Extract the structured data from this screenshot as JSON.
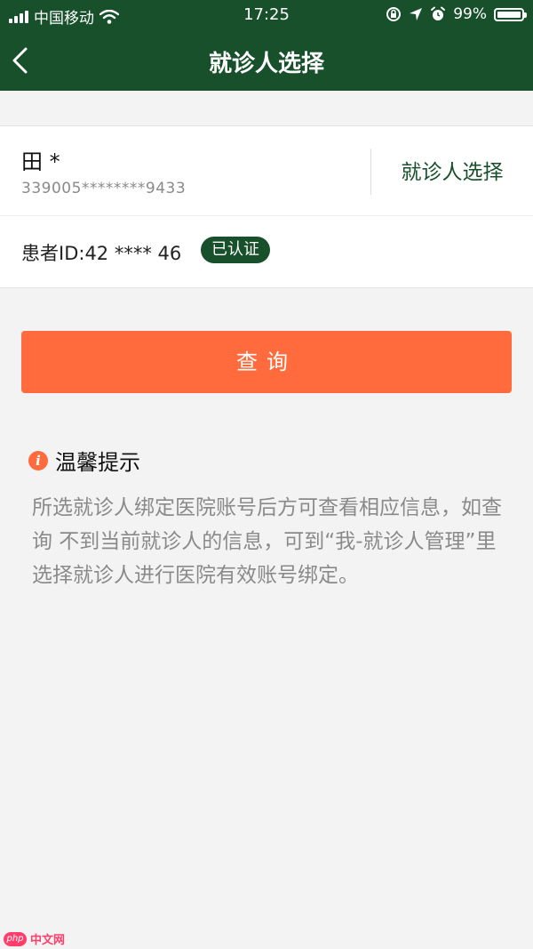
{
  "status_bar": {
    "carrier": "中国移动",
    "time": "17:25",
    "battery": "99%"
  },
  "nav": {
    "title": "就诊人选择"
  },
  "patient": {
    "name": "田 *",
    "id_number": "339005********9433",
    "select_label": "就诊人选择"
  },
  "patient_row": {
    "patient_id": "患者ID:42 **** 46",
    "badge": "已认证"
  },
  "query_button": {
    "label": "查询"
  },
  "tips": {
    "title": "温馨提示",
    "body": "所选就诊人绑定医院账号后方可查看相应信息，如查询 不到当前就诊人的信息，可到“我-就诊人管理”里选择就诊人进行医院有效账号绑定。"
  },
  "watermark": {
    "logo": "php",
    "text": "中文网"
  },
  "colors": {
    "header": "#17502a",
    "accent": "#ff6b3d",
    "background": "#f4f3f3"
  },
  "icons": [
    "signal-icon",
    "wifi-icon",
    "orientation-lock-icon",
    "location-icon",
    "alarm-icon",
    "battery-icon",
    "back-chevron-icon",
    "info-icon"
  ]
}
